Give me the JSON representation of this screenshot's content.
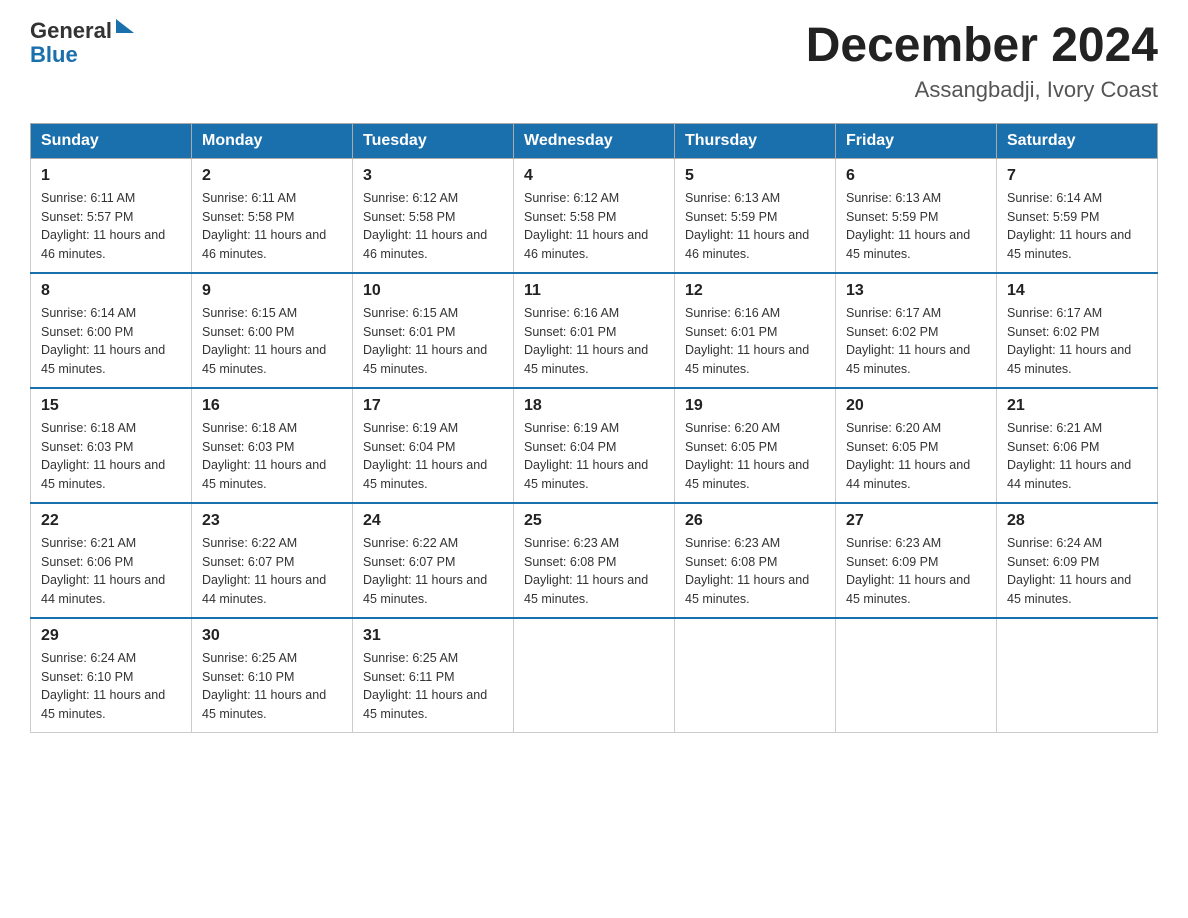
{
  "logo": {
    "line1": "General",
    "line2": "Blue"
  },
  "header": {
    "month_year": "December 2024",
    "location": "Assangbadji, Ivory Coast"
  },
  "days_of_week": [
    "Sunday",
    "Monday",
    "Tuesday",
    "Wednesday",
    "Thursday",
    "Friday",
    "Saturday"
  ],
  "weeks": [
    [
      {
        "day": "1",
        "sunrise": "6:11 AM",
        "sunset": "5:57 PM",
        "daylight": "11 hours and 46 minutes."
      },
      {
        "day": "2",
        "sunrise": "6:11 AM",
        "sunset": "5:58 PM",
        "daylight": "11 hours and 46 minutes."
      },
      {
        "day": "3",
        "sunrise": "6:12 AM",
        "sunset": "5:58 PM",
        "daylight": "11 hours and 46 minutes."
      },
      {
        "day": "4",
        "sunrise": "6:12 AM",
        "sunset": "5:58 PM",
        "daylight": "11 hours and 46 minutes."
      },
      {
        "day": "5",
        "sunrise": "6:13 AM",
        "sunset": "5:59 PM",
        "daylight": "11 hours and 46 minutes."
      },
      {
        "day": "6",
        "sunrise": "6:13 AM",
        "sunset": "5:59 PM",
        "daylight": "11 hours and 45 minutes."
      },
      {
        "day": "7",
        "sunrise": "6:14 AM",
        "sunset": "5:59 PM",
        "daylight": "11 hours and 45 minutes."
      }
    ],
    [
      {
        "day": "8",
        "sunrise": "6:14 AM",
        "sunset": "6:00 PM",
        "daylight": "11 hours and 45 minutes."
      },
      {
        "day": "9",
        "sunrise": "6:15 AM",
        "sunset": "6:00 PM",
        "daylight": "11 hours and 45 minutes."
      },
      {
        "day": "10",
        "sunrise": "6:15 AM",
        "sunset": "6:01 PM",
        "daylight": "11 hours and 45 minutes."
      },
      {
        "day": "11",
        "sunrise": "6:16 AM",
        "sunset": "6:01 PM",
        "daylight": "11 hours and 45 minutes."
      },
      {
        "day": "12",
        "sunrise": "6:16 AM",
        "sunset": "6:01 PM",
        "daylight": "11 hours and 45 minutes."
      },
      {
        "day": "13",
        "sunrise": "6:17 AM",
        "sunset": "6:02 PM",
        "daylight": "11 hours and 45 minutes."
      },
      {
        "day": "14",
        "sunrise": "6:17 AM",
        "sunset": "6:02 PM",
        "daylight": "11 hours and 45 minutes."
      }
    ],
    [
      {
        "day": "15",
        "sunrise": "6:18 AM",
        "sunset": "6:03 PM",
        "daylight": "11 hours and 45 minutes."
      },
      {
        "day": "16",
        "sunrise": "6:18 AM",
        "sunset": "6:03 PM",
        "daylight": "11 hours and 45 minutes."
      },
      {
        "day": "17",
        "sunrise": "6:19 AM",
        "sunset": "6:04 PM",
        "daylight": "11 hours and 45 minutes."
      },
      {
        "day": "18",
        "sunrise": "6:19 AM",
        "sunset": "6:04 PM",
        "daylight": "11 hours and 45 minutes."
      },
      {
        "day": "19",
        "sunrise": "6:20 AM",
        "sunset": "6:05 PM",
        "daylight": "11 hours and 45 minutes."
      },
      {
        "day": "20",
        "sunrise": "6:20 AM",
        "sunset": "6:05 PM",
        "daylight": "11 hours and 44 minutes."
      },
      {
        "day": "21",
        "sunrise": "6:21 AM",
        "sunset": "6:06 PM",
        "daylight": "11 hours and 44 minutes."
      }
    ],
    [
      {
        "day": "22",
        "sunrise": "6:21 AM",
        "sunset": "6:06 PM",
        "daylight": "11 hours and 44 minutes."
      },
      {
        "day": "23",
        "sunrise": "6:22 AM",
        "sunset": "6:07 PM",
        "daylight": "11 hours and 44 minutes."
      },
      {
        "day": "24",
        "sunrise": "6:22 AM",
        "sunset": "6:07 PM",
        "daylight": "11 hours and 45 minutes."
      },
      {
        "day": "25",
        "sunrise": "6:23 AM",
        "sunset": "6:08 PM",
        "daylight": "11 hours and 45 minutes."
      },
      {
        "day": "26",
        "sunrise": "6:23 AM",
        "sunset": "6:08 PM",
        "daylight": "11 hours and 45 minutes."
      },
      {
        "day": "27",
        "sunrise": "6:23 AM",
        "sunset": "6:09 PM",
        "daylight": "11 hours and 45 minutes."
      },
      {
        "day": "28",
        "sunrise": "6:24 AM",
        "sunset": "6:09 PM",
        "daylight": "11 hours and 45 minutes."
      }
    ],
    [
      {
        "day": "29",
        "sunrise": "6:24 AM",
        "sunset": "6:10 PM",
        "daylight": "11 hours and 45 minutes."
      },
      {
        "day": "30",
        "sunrise": "6:25 AM",
        "sunset": "6:10 PM",
        "daylight": "11 hours and 45 minutes."
      },
      {
        "day": "31",
        "sunrise": "6:25 AM",
        "sunset": "6:11 PM",
        "daylight": "11 hours and 45 minutes."
      },
      null,
      null,
      null,
      null
    ]
  ]
}
